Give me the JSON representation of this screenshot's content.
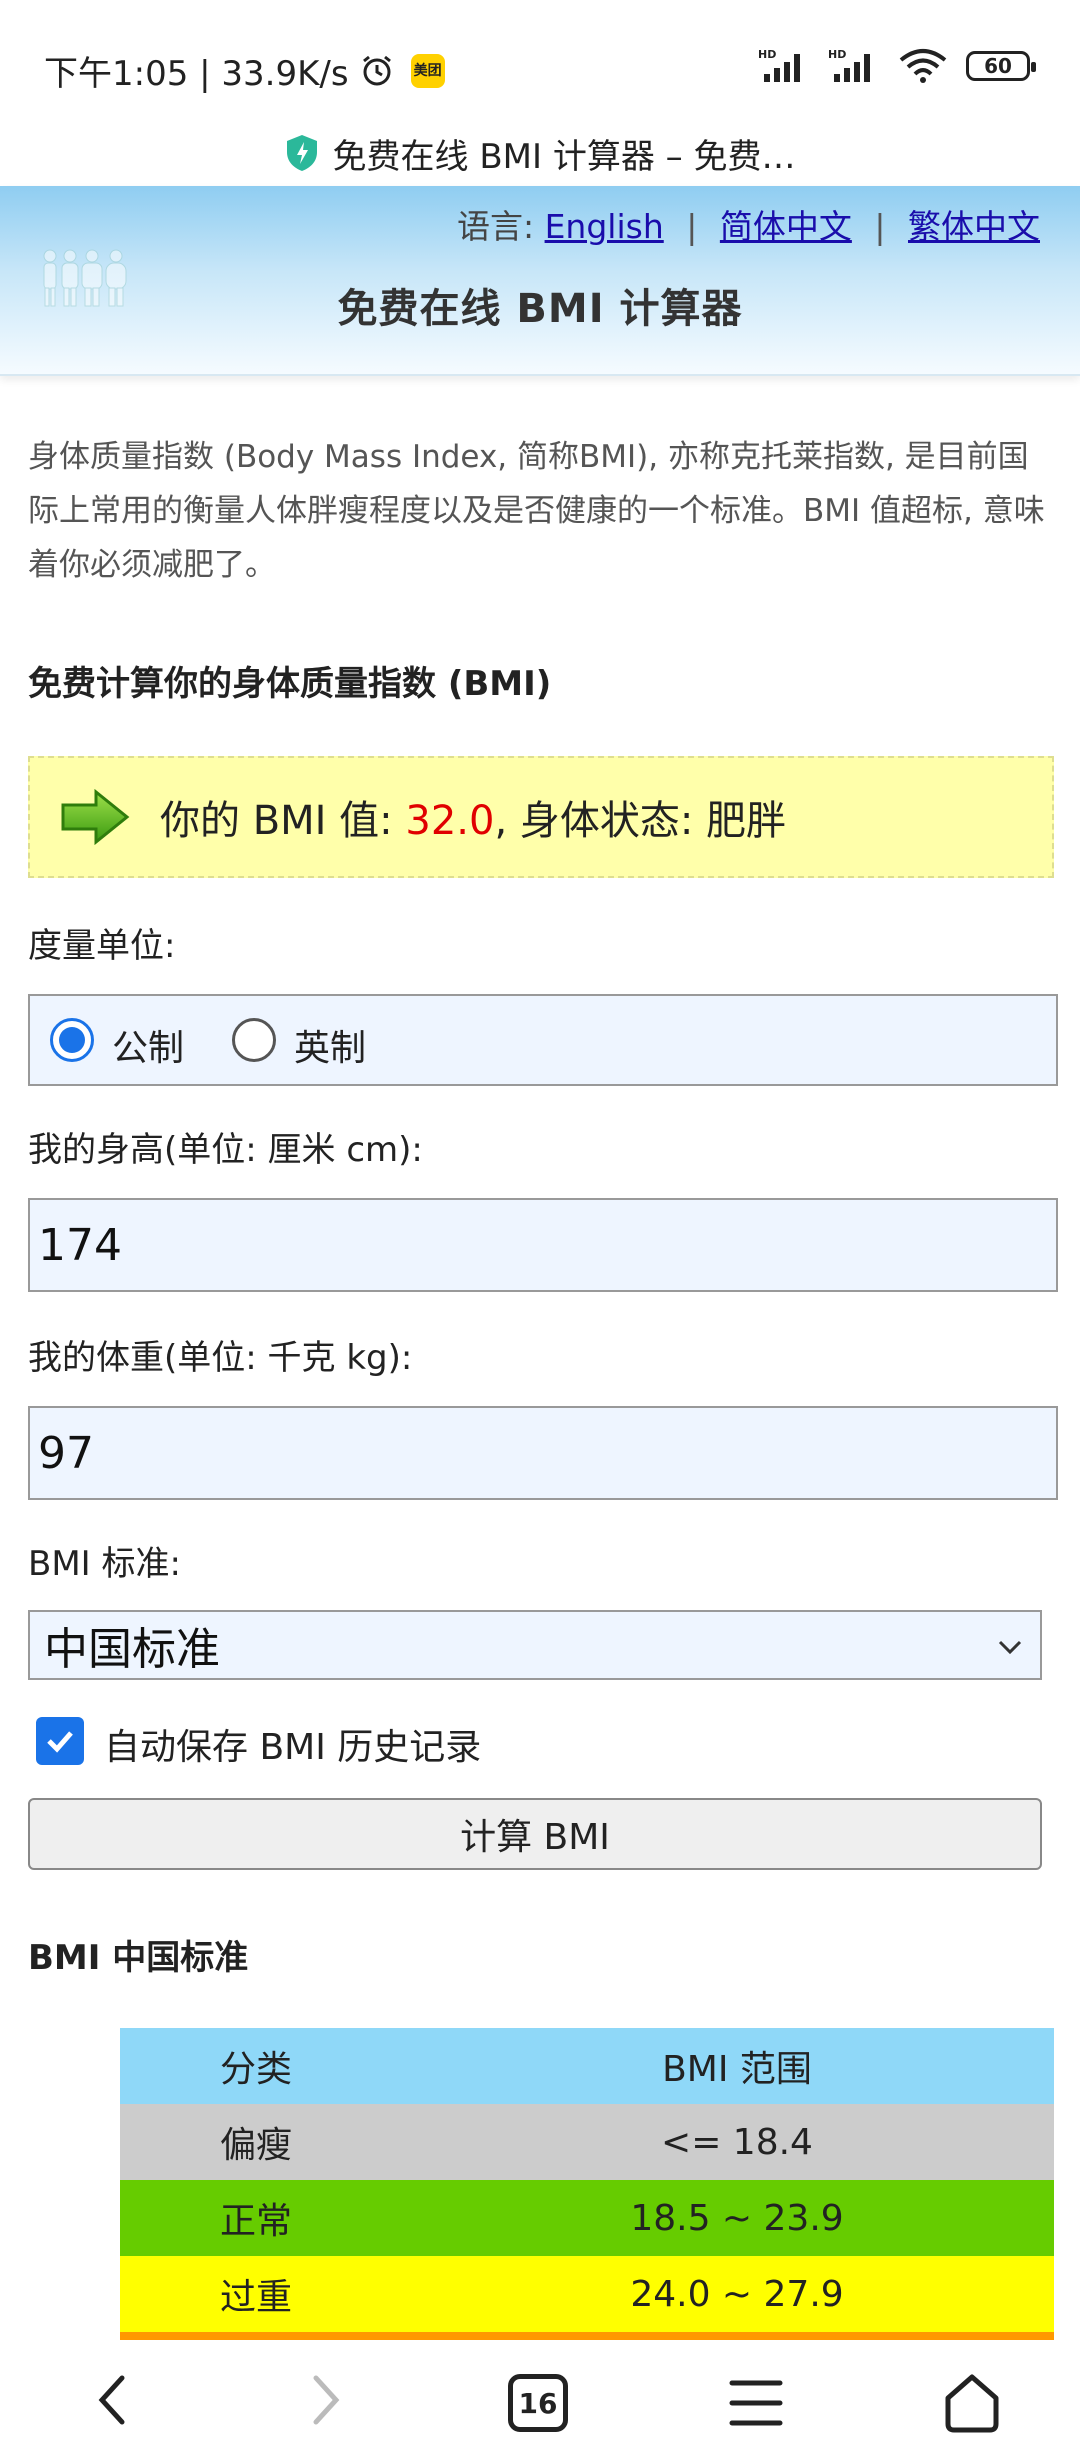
{
  "status_bar": {
    "left_text": "下午1:05 | 33.9K/s",
    "meituan_icon_label": "美团",
    "battery": "60"
  },
  "url_bar": {
    "title": "免费在线 BMI 计算器 – 免费…"
  },
  "header": {
    "lang_prefix": "语言:",
    "lang_en": "English",
    "lang_sc": "简体中文",
    "lang_tc": "繁体中文",
    "sep": "|",
    "site_title": "免费在线 BMI 计算器"
  },
  "intro": "身体质量指数 (Body Mass Index, 简称BMI), 亦称克托莱指数, 是目前国际上常用的衡量人体胖瘦程度以及是否健康的一个标准。BMI 值超标, 意味着你必须减肥了。",
  "calc_title": "免费计算你的身体质量指数 (BMI)",
  "result": {
    "prefix": "你的 BMI 值: ",
    "value": "32.0",
    "suffix": ", 身体状态: 肥胖"
  },
  "form": {
    "unit_label": "度量单位:",
    "unit_metric": "公制",
    "unit_imperial": "英制",
    "height_label": "我的身高(单位: 厘米 cm):",
    "height_value": "174",
    "weight_label": "我的体重(单位: 千克 kg):",
    "weight_value": "97",
    "standard_label": "BMI 标准:",
    "standard_value": "中国标准",
    "autosave_label": "自动保存 BMI 历史记录",
    "calc_button": "计算 BMI"
  },
  "standard_section_title": "BMI 中国标准",
  "table": {
    "headers": [
      "分类",
      "BMI 范围"
    ],
    "rows": [
      {
        "category": "偏瘦",
        "range": "<= 18.4",
        "color": "#cccccc"
      },
      {
        "category": "正常",
        "range": "18.5 ~ 23.9",
        "color": "#66cc00"
      },
      {
        "category": "过重",
        "range": "24.0 ~ 27.9",
        "color": "#ffff00"
      }
    ],
    "header_color": "#8fd8f8",
    "next_row_color": "#ff9900"
  },
  "nav": {
    "tabs_count": "16"
  }
}
